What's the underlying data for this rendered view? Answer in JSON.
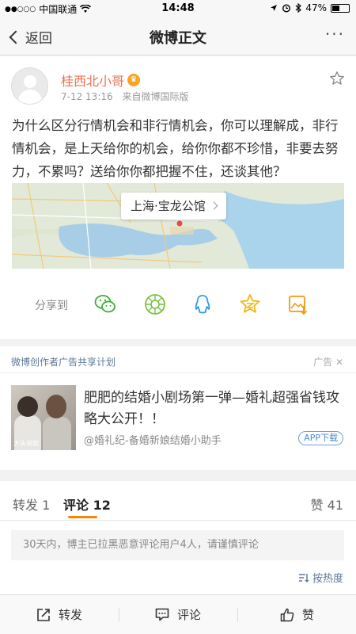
{
  "status_bar": {
    "carrier": "中国联通",
    "time": "14:48",
    "battery": "47%",
    "battery_level": 0.47
  },
  "nav": {
    "back_label": "返回",
    "title": "微博正文",
    "more_label": "···"
  },
  "post": {
    "username": "桂西北小哥",
    "date": "7-12 13:16",
    "source": "来自微博国际版",
    "text": "为什么区分行情机会和非行情机会，你可以理解成，非行情机会，是上天给你的机会，给你你都不珍惜，非要去努力，不累吗？送给你你都把握不住，还谈其他？",
    "location": "上海·宝龙公馆",
    "share_label": "分享到"
  },
  "ad": {
    "program": "微博创作者广告共享计划",
    "tag": "广告",
    "image_caption": "大头说剧",
    "title": "肥肥的结婚小剧场第一弹—婚礼超强省钱攻略大公开！！",
    "source": "@婚礼纪-备婚新娘结婚小助手",
    "button": "APP下载"
  },
  "tabs": {
    "repost_label": "转发",
    "repost_count": "1",
    "comment_label": "评论",
    "comment_count": "12",
    "like_label": "赞",
    "like_count": "41"
  },
  "comments": {
    "notice": "30天内，博主已拉黑恶意评论用户4人，请谨慎评论",
    "sort_label": "按热度"
  },
  "bottom_bar": {
    "repost": "转发",
    "comment": "评论",
    "like": "赞"
  }
}
